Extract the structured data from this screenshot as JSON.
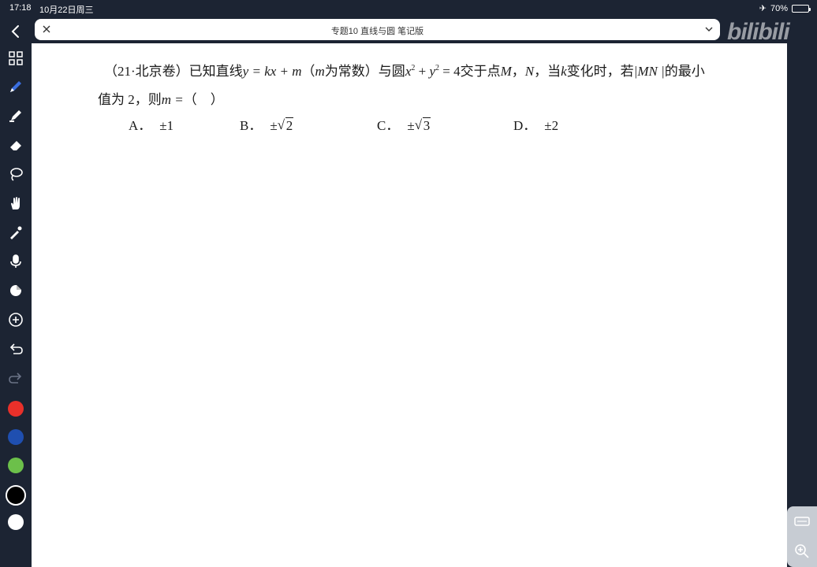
{
  "status": {
    "time": "17:18",
    "date": "10月22日周三",
    "battery": "70%",
    "battery_fraction": 0.7
  },
  "titlebar": {
    "title": "专题10 直线与圆 笔记版"
  },
  "watermark": {
    "text": "bilibili"
  },
  "question": {
    "source": "（21·北京卷）已知直线",
    "eq1": "y = kx + m",
    "part2": "（",
    "m_var": "m",
    "part3": "为常数）与圆",
    "circle_x": "x",
    "circle_plus": " + ",
    "circle_y": "y",
    "sup2": "2",
    "circle_eq": " = 4",
    "part4": "交于点",
    "pointM": "M",
    "comma": "，",
    "pointN": "N",
    "part5": "，当",
    "k_var": "k",
    "part6": "变化时，若",
    "mn": "|MN |",
    "part7": "的最小",
    "line2_a": "值为 2，则",
    "m_eq": "m =",
    "line2_b": "（　）"
  },
  "options": [
    {
      "letter": "A．",
      "value": "±1"
    },
    {
      "letter": "B．",
      "prefix": "±",
      "radicand": "2"
    },
    {
      "letter": "C．",
      "prefix": "±",
      "radicand": "3"
    },
    {
      "letter": "D．",
      "value": "±2"
    }
  ],
  "colors": {
    "red": "#e8302a",
    "blue": "#1f4fb0",
    "green": "#6cc04a",
    "black": "#000000",
    "white": "#ffffff",
    "toolbar_bg": "#1c2433"
  }
}
